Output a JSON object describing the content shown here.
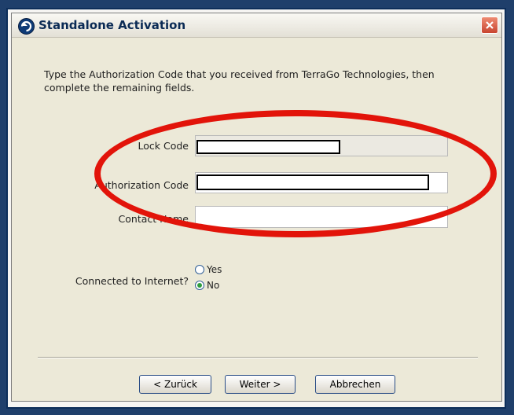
{
  "dialog": {
    "title": "Standalone Activation",
    "instruction": "Type the Authorization Code that you received from TerraGo Technologies, then complete the remaining fields."
  },
  "form": {
    "lock_code_label": "Lock Code",
    "authorization_code_label": "Authorization Code",
    "contact_name_label": "Contact Name",
    "internet_label": "Connected to Internet?",
    "options": [
      "Yes",
      "No"
    ],
    "selected": "No"
  },
  "buttons": {
    "back": "< Zurück",
    "next": "Weiter >",
    "cancel": "Abbrechen"
  },
  "annotation": {
    "ellipse_color": "#e2140a"
  }
}
